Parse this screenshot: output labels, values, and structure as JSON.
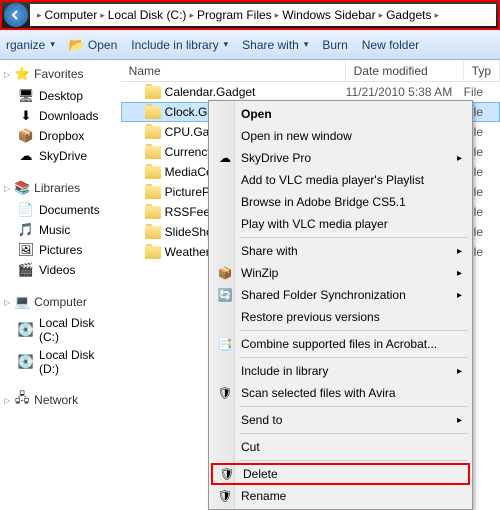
{
  "breadcrumbs": [
    "Computer",
    "Local Disk (C:)",
    "Program Files",
    "Windows Sidebar",
    "Gadgets"
  ],
  "toolbar": {
    "organize": "rganize",
    "open": "Open",
    "include": "Include in library",
    "share": "Share with",
    "burn": "Burn",
    "newfolder": "New folder"
  },
  "sidebar": {
    "favorites": {
      "label": "Favorites",
      "items": [
        {
          "icon": "desktop",
          "label": "Desktop"
        },
        {
          "icon": "download",
          "label": "Downloads"
        },
        {
          "icon": "dropbox",
          "label": "Dropbox"
        },
        {
          "icon": "skydrive",
          "label": "SkyDrive"
        }
      ]
    },
    "libraries": {
      "label": "Libraries",
      "items": [
        {
          "icon": "doc",
          "label": "Documents"
        },
        {
          "icon": "music",
          "label": "Music"
        },
        {
          "icon": "pic",
          "label": "Pictures"
        },
        {
          "icon": "video",
          "label": "Videos"
        }
      ]
    },
    "computer": {
      "label": "Computer",
      "items": [
        {
          "icon": "disk",
          "label": "Local Disk (C:)"
        },
        {
          "icon": "disk",
          "label": "Local Disk (D:)"
        }
      ]
    },
    "network": {
      "label": "Network"
    }
  },
  "columns": {
    "name": "Name",
    "date": "Date modified",
    "type": "Typ"
  },
  "files": [
    {
      "name": "Calendar.Gadget",
      "date": "11/21/2010 5:38 AM",
      "type": "File",
      "sel": false
    },
    {
      "name": "Clock.Gad",
      "date": "",
      "type": "File",
      "sel": true
    },
    {
      "name": "CPU.Gadg",
      "date": "",
      "type": "File",
      "sel": false
    },
    {
      "name": "Currency.",
      "date": "",
      "type": "File",
      "sel": false
    },
    {
      "name": "MediaCen",
      "date": "",
      "type": "File",
      "sel": false
    },
    {
      "name": "PicturePu",
      "date": "",
      "type": "File",
      "sel": false
    },
    {
      "name": "RSSFeeds.",
      "date": "",
      "type": "File",
      "sel": false
    },
    {
      "name": "SlideShow",
      "date": "",
      "type": "File",
      "sel": false
    },
    {
      "name": "Weather.G",
      "date": "",
      "type": "File",
      "sel": false
    }
  ],
  "context": [
    {
      "t": "item",
      "label": "Open",
      "bold": true
    },
    {
      "t": "item",
      "label": "Open in new window"
    },
    {
      "t": "item",
      "label": "SkyDrive Pro",
      "sub": true,
      "ico": "cloud"
    },
    {
      "t": "item",
      "label": "Add to VLC media player's Playlist"
    },
    {
      "t": "item",
      "label": "Browse in Adobe Bridge CS5.1"
    },
    {
      "t": "item",
      "label": "Play with VLC media player"
    },
    {
      "t": "sep"
    },
    {
      "t": "item",
      "label": "Share with",
      "sub": true
    },
    {
      "t": "item",
      "label": "WinZip",
      "sub": true,
      "ico": "zip"
    },
    {
      "t": "item",
      "label": "Shared Folder Synchronization",
      "sub": true,
      "ico": "sync"
    },
    {
      "t": "item",
      "label": "Restore previous versions"
    },
    {
      "t": "sep"
    },
    {
      "t": "item",
      "label": "Combine supported files in Acrobat...",
      "ico": "pdf"
    },
    {
      "t": "sep"
    },
    {
      "t": "item",
      "label": "Include in library",
      "sub": true
    },
    {
      "t": "item",
      "label": "Scan selected files with Avira",
      "ico": "avira"
    },
    {
      "t": "sep"
    },
    {
      "t": "item",
      "label": "Send to",
      "sub": true
    },
    {
      "t": "sep"
    },
    {
      "t": "item",
      "label": "Cut"
    },
    {
      "t": "sep"
    },
    {
      "t": "item",
      "label": "Delete",
      "ico": "shield",
      "hl": true
    },
    {
      "t": "item",
      "label": "Rename",
      "ico": "shield"
    }
  ]
}
